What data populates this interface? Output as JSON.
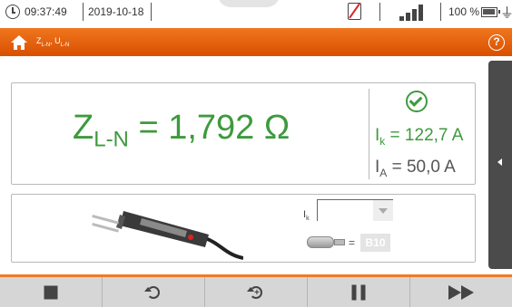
{
  "status": {
    "time": "09:37:49",
    "date": "2019-10-18",
    "battery_percent": "100 %",
    "signal_bars": 4
  },
  "titlebar": {
    "title_z": "Z",
    "title_z_sub": "L-N",
    "title_sep": ", U",
    "title_u_sub": "L-N",
    "help_label": "?"
  },
  "result": {
    "main_symbol": "Z",
    "main_sub": "L-N",
    "main_value": " = 1,792 Ω",
    "ik_symbol": "I",
    "ik_sub": "k",
    "ik_value": " = 122,7 A",
    "ia_symbol": "I",
    "ia_sub": "A",
    "ia_value": " = 50,0 A",
    "status": "ok"
  },
  "settings": {
    "ik_label": "I",
    "ik_label_sub": "k",
    "ik_selected": "",
    "fuse_equals": "=",
    "fuse_value": "B10"
  },
  "colors": {
    "accent": "#e66112",
    "result_green": "#3d9a3d",
    "toolbar": "#d6d6d6"
  },
  "toolbar": {
    "buttons": [
      "stop-icon",
      "return-icon",
      "return-plus-icon",
      "pause-icon",
      "fast-forward-icon"
    ]
  }
}
